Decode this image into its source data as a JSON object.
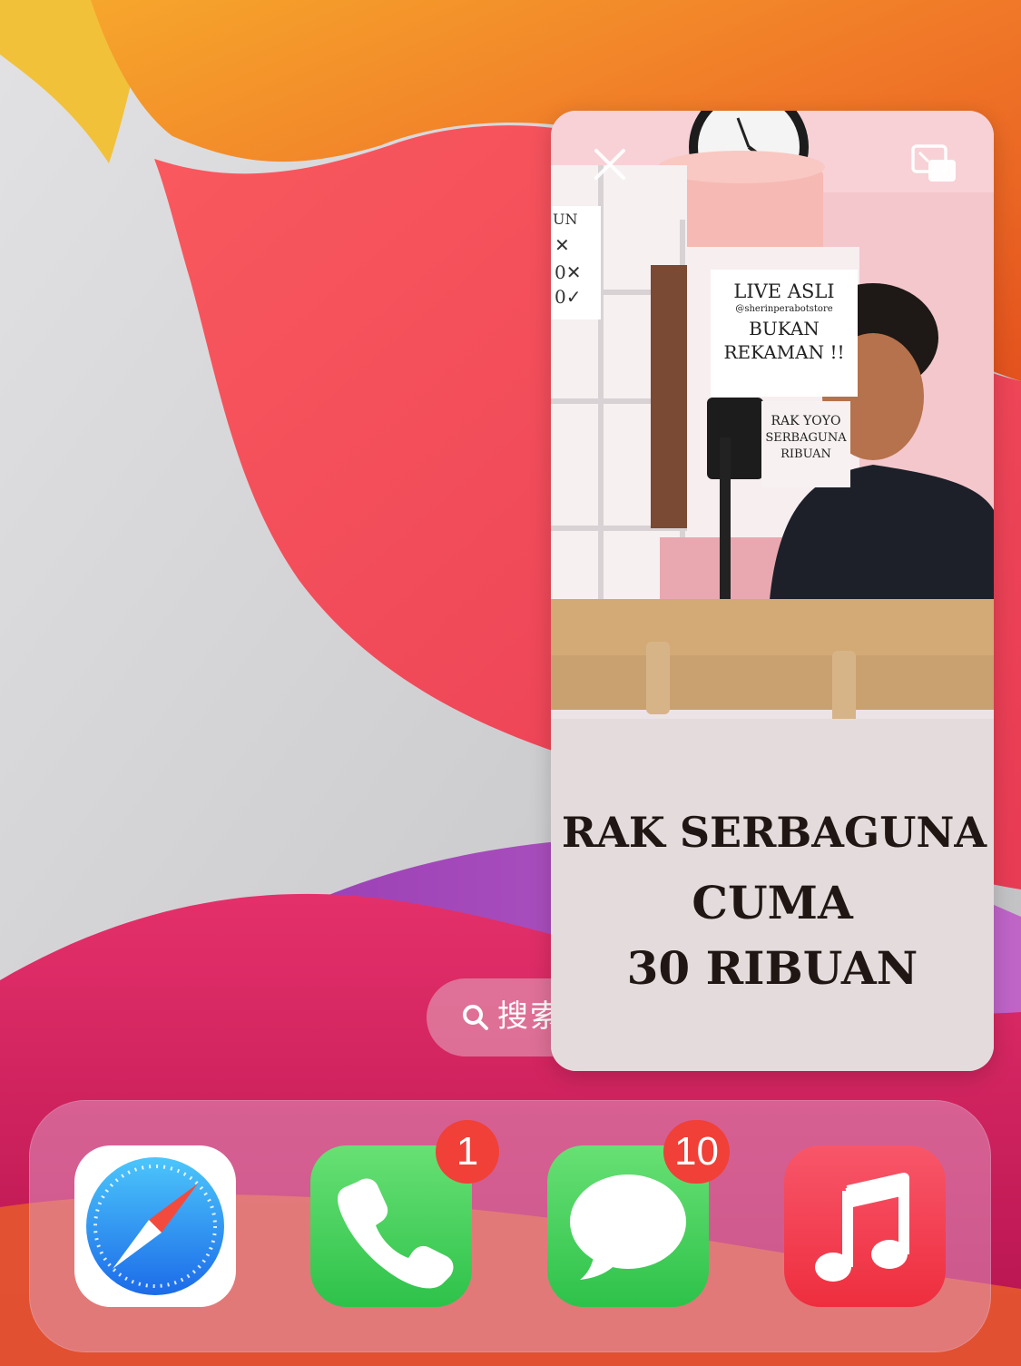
{
  "search": {
    "label": "搜索"
  },
  "pip": {
    "video_overlay": {
      "line1": "RAK SERBAGUNA",
      "line2": "CUMA",
      "line3": "30 RIBUAN"
    },
    "poster_live": {
      "line1": "LIVE ASLI",
      "line2": "@sherinperabotstore",
      "line3": "BUKAN",
      "line4": "REKAMAN !!"
    },
    "poster_rak": {
      "line1": "RAK YOYO",
      "line2": "SERBAGUNA",
      "line3": "RIBUAN"
    },
    "close_icon": "close-icon",
    "expand_icon": "picture-in-picture-restore-icon"
  },
  "dock": {
    "apps": [
      {
        "name": "Safari",
        "icon": "safari-compass-icon",
        "badge": ""
      },
      {
        "name": "Phone",
        "icon": "phone-icon",
        "badge": "1"
      },
      {
        "name": "Messages",
        "icon": "messages-bubble-icon",
        "badge": "10"
      },
      {
        "name": "Music",
        "icon": "music-note-icon",
        "badge": ""
      }
    ]
  },
  "colors": {
    "wallpaper_orange": "#f07a28",
    "wallpaper_red": "#f0485a",
    "wallpaper_purple": "#b25ab8",
    "badge_red": "#f04038",
    "phone_green": "#4fd964",
    "music_red": "#f3404e"
  }
}
